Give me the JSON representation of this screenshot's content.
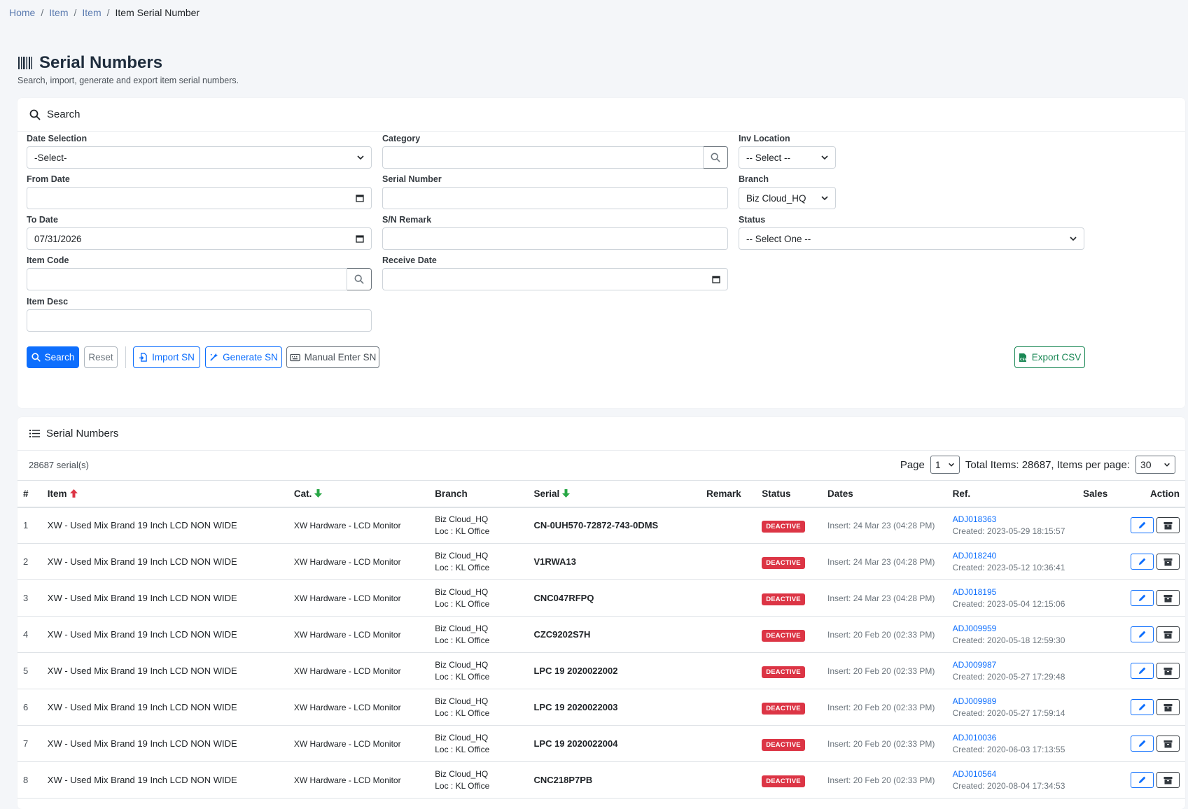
{
  "breadcrumb": [
    "Home",
    "Item",
    "Item",
    "Item Serial Number"
  ],
  "page": {
    "title": "Serial Numbers",
    "subtitle": "Search, import, generate and export item serial numbers."
  },
  "search": {
    "header": "Search",
    "date_selection": {
      "label": "Date Selection",
      "value": "-Select-"
    },
    "from_date": {
      "label": "From Date",
      "value": ""
    },
    "to_date": {
      "label": "To Date",
      "value": "07/31/2026"
    },
    "item_code": {
      "label": "Item Code",
      "value": ""
    },
    "item_desc": {
      "label": "Item Desc",
      "value": ""
    },
    "category": {
      "label": "Category",
      "value": ""
    },
    "serial_number": {
      "label": "Serial Number",
      "value": ""
    },
    "sn_remark": {
      "label": "S/N Remark",
      "value": ""
    },
    "receive_date": {
      "label": "Receive Date",
      "value": ""
    },
    "inv_location": {
      "label": "Inv Location",
      "value": "-- Select --"
    },
    "branch": {
      "label": "Branch",
      "value": "Biz Cloud_HQ"
    },
    "status": {
      "label": "Status",
      "value": "-- Select One --"
    },
    "buttons": {
      "search": "Search",
      "reset": "Reset",
      "import": "Import SN",
      "generate": "Generate SN",
      "manual": "Manual Enter SN",
      "export": "Export CSV"
    }
  },
  "list": {
    "header": "Serial Numbers",
    "count": "28687 serial(s)",
    "page_label": "Page",
    "page_value": "1",
    "total_text": "Total Items: 28687, Items per page:",
    "per_page": "30",
    "columns": [
      "#",
      "Item",
      "Cat.",
      "Branch",
      "Serial",
      "Remark",
      "Status",
      "Dates",
      "Ref.",
      "Sales",
      "Action"
    ],
    "rows": [
      {
        "num": "1",
        "item": "XW - Used Mix Brand 19 Inch LCD NON WIDE",
        "cat": "XW Hardware - LCD Monitor",
        "branch": "Biz Cloud_HQ",
        "loc": "Loc : KL Office",
        "serial": "CN-0UH570-72872-743-0DMS",
        "remark": "",
        "status": "DEACTIVE",
        "dates": "Insert: 24 Mar 23 (04:28 PM)",
        "ref": "ADJ018363",
        "created": "Created: 2023-05-29 18:15:57",
        "sales": ""
      },
      {
        "num": "2",
        "item": "XW - Used Mix Brand 19 Inch LCD NON WIDE",
        "cat": "XW Hardware - LCD Monitor",
        "branch": "Biz Cloud_HQ",
        "loc": "Loc : KL Office",
        "serial": "V1RWA13",
        "remark": "",
        "status": "DEACTIVE",
        "dates": "Insert: 24 Mar 23 (04:28 PM)",
        "ref": "ADJ018240",
        "created": "Created: 2023-05-12 10:36:41",
        "sales": ""
      },
      {
        "num": "3",
        "item": "XW - Used Mix Brand 19 Inch LCD NON WIDE",
        "cat": "XW Hardware - LCD Monitor",
        "branch": "Biz Cloud_HQ",
        "loc": "Loc : KL Office",
        "serial": "CNC047RFPQ",
        "remark": "",
        "status": "DEACTIVE",
        "dates": "Insert: 24 Mar 23 (04:28 PM)",
        "ref": "ADJ018195",
        "created": "Created: 2023-05-04 12:15:06",
        "sales": ""
      },
      {
        "num": "4",
        "item": "XW - Used Mix Brand 19 Inch LCD NON WIDE",
        "cat": "XW Hardware - LCD Monitor",
        "branch": "Biz Cloud_HQ",
        "loc": "Loc : KL Office",
        "serial": "CZC9202S7H",
        "remark": "",
        "status": "DEACTIVE",
        "dates": "Insert: 20 Feb 20 (02:33 PM)",
        "ref": "ADJ009959",
        "created": "Created: 2020-05-18 12:59:30",
        "sales": ""
      },
      {
        "num": "5",
        "item": "XW - Used Mix Brand 19 Inch LCD NON WIDE",
        "cat": "XW Hardware - LCD Monitor",
        "branch": "Biz Cloud_HQ",
        "loc": "Loc : KL Office",
        "serial": "LPC 19 2020022002",
        "remark": "",
        "status": "DEACTIVE",
        "dates": "Insert: 20 Feb 20 (02:33 PM)",
        "ref": "ADJ009987",
        "created": "Created: 2020-05-27 17:29:48",
        "sales": ""
      },
      {
        "num": "6",
        "item": "XW - Used Mix Brand 19 Inch LCD NON WIDE",
        "cat": "XW Hardware - LCD Monitor",
        "branch": "Biz Cloud_HQ",
        "loc": "Loc : KL Office",
        "serial": "LPC 19 2020022003",
        "remark": "",
        "status": "DEACTIVE",
        "dates": "Insert: 20 Feb 20 (02:33 PM)",
        "ref": "ADJ009989",
        "created": "Created: 2020-05-27 17:59:14",
        "sales": ""
      },
      {
        "num": "7",
        "item": "XW - Used Mix Brand 19 Inch LCD NON WIDE",
        "cat": "XW Hardware - LCD Monitor",
        "branch": "Biz Cloud_HQ",
        "loc": "Loc : KL Office",
        "serial": "LPC 19 2020022004",
        "remark": "",
        "status": "DEACTIVE",
        "dates": "Insert: 20 Feb 20 (02:33 PM)",
        "ref": "ADJ010036",
        "created": "Created: 2020-06-03 17:13:55",
        "sales": ""
      },
      {
        "num": "8",
        "item": "XW - Used Mix Brand 19 Inch LCD NON WIDE",
        "cat": "XW Hardware - LCD Monitor",
        "branch": "Biz Cloud_HQ",
        "loc": "Loc : KL Office",
        "serial": "CNC218P7PB",
        "remark": "",
        "status": "DEACTIVE",
        "dates": "Insert: 20 Feb 20 (02:33 PM)",
        "ref": "ADJ010564",
        "created": "Created: 2020-08-04 17:34:53",
        "sales": ""
      }
    ]
  },
  "icons": {
    "title": "barcode-icon",
    "search": "search-icon",
    "list": "list-icon",
    "import": "file-import-icon",
    "generate": "magic-wand-icon",
    "manual": "keyboard-icon",
    "export": "file-csv-icon",
    "edit": "pencil-icon",
    "archive": "box-icon",
    "sort_up": "arrow-up-icon",
    "sort_down": "arrow-down-icon"
  },
  "colors": {
    "primary": "#0d6efd",
    "danger": "#dc3545",
    "success": "#198754",
    "sort_up": "#dc3545",
    "sort_down": "#28a745",
    "background": "#f4f6f9"
  }
}
